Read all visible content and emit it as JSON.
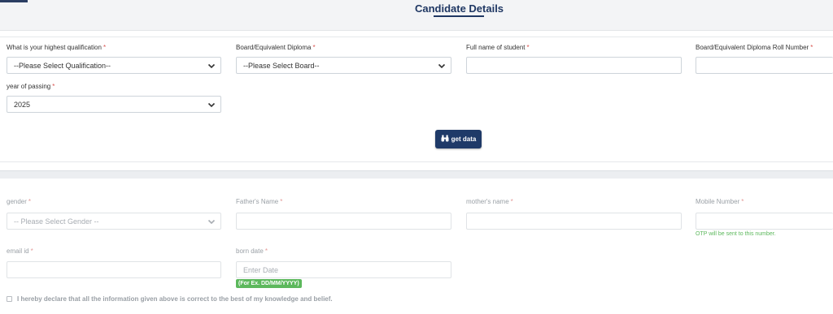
{
  "header": {
    "title": "Candidate Details"
  },
  "search": {
    "qualification": {
      "label": "What is your highest qualification",
      "value": "--Please Select Qualification--"
    },
    "board": {
      "label": "Board/Equivalent Diploma",
      "value": "--Please Select Board--"
    },
    "student_name": {
      "label": "Full name of student",
      "value": ""
    },
    "roll_number": {
      "label": "Board/Equivalent Diploma Roll Number",
      "value": ""
    },
    "year": {
      "label": "year of passing",
      "value": "2025"
    },
    "get_data_label": "get data"
  },
  "details": {
    "gender": {
      "label": "gender",
      "value": "-- Please Select Gender --"
    },
    "father_name": {
      "label": "Father's Name",
      "value": ""
    },
    "mother_name": {
      "label": "mother's name",
      "value": ""
    },
    "mobile": {
      "label": "Mobile Number",
      "value": "",
      "hint": "OTP will be sent to this number."
    },
    "email": {
      "label": "email id",
      "value": ""
    },
    "dob": {
      "label": "born date",
      "placeholder": "Enter Date",
      "format_hint": "(For Ex. DD/MM/YYYY)"
    },
    "required_mark": "*"
  },
  "declaration": {
    "text": "I hereby declare that all the information given above is correct to the best of my knowledge and belief.",
    "checked": false
  },
  "colors": {
    "brand": "#1f3763",
    "button": "#1f3a68",
    "required": "#d9534f",
    "hint": "#5cb85c"
  },
  "icons": {
    "get_data": "binoculars-icon",
    "select": "chevron-down-icon"
  }
}
